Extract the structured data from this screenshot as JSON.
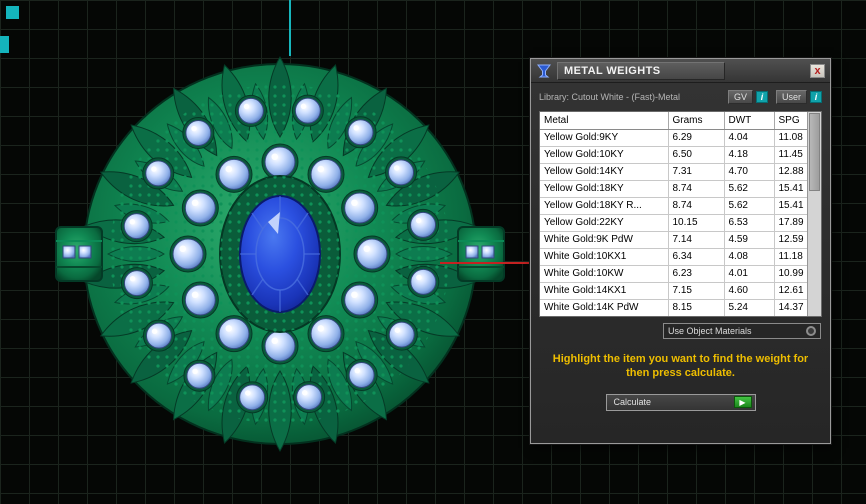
{
  "dialog": {
    "title": "METAL WEIGHTS",
    "close_label": "x",
    "library_label": "Library: Cutout White - (Fast)-Metal",
    "gv_button": "GV",
    "gv_info": "i",
    "user_button": "User",
    "user_info": "i",
    "table": {
      "columns": [
        "Metal",
        "Grams",
        "DWT",
        "SPG"
      ],
      "rows": [
        [
          "Yellow Gold:9KY",
          "6.29",
          "4.04",
          "11.08"
        ],
        [
          "Yellow Gold:10KY",
          "6.50",
          "4.18",
          "11.45"
        ],
        [
          "Yellow Gold:14KY",
          "7.31",
          "4.70",
          "12.88"
        ],
        [
          "Yellow Gold:18KY",
          "8.74",
          "5.62",
          "15.41"
        ],
        [
          "Yellow Gold:18KY R...",
          "8.74",
          "5.62",
          "15.41"
        ],
        [
          "Yellow Gold:22KY",
          "10.15",
          "6.53",
          "17.89"
        ],
        [
          "White Gold:9K PdW",
          "7.14",
          "4.59",
          "12.59"
        ],
        [
          "White Gold:10KX1",
          "6.34",
          "4.08",
          "11.18"
        ],
        [
          "White Gold:10KW",
          "6.23",
          "4.01",
          "10.99"
        ],
        [
          "White Gold:14KX1",
          "7.15",
          "4.60",
          "12.61"
        ],
        [
          "White Gold:14K PdW",
          "8.15",
          "5.24",
          "14.37"
        ]
      ]
    },
    "materials_dropdown": "Use Object Materials",
    "instruction": "Highlight the item you want to find the weight for then press calculate.",
    "calculate_label": "Calculate",
    "calculate_arrow": "▶"
  },
  "colors": {
    "accent_teal": "#14b4bc",
    "axis_red": "#c42222",
    "gold_text": "#eebe00",
    "metal_green": "#0b7a4e",
    "gem_blue": "#1f3fd4"
  }
}
